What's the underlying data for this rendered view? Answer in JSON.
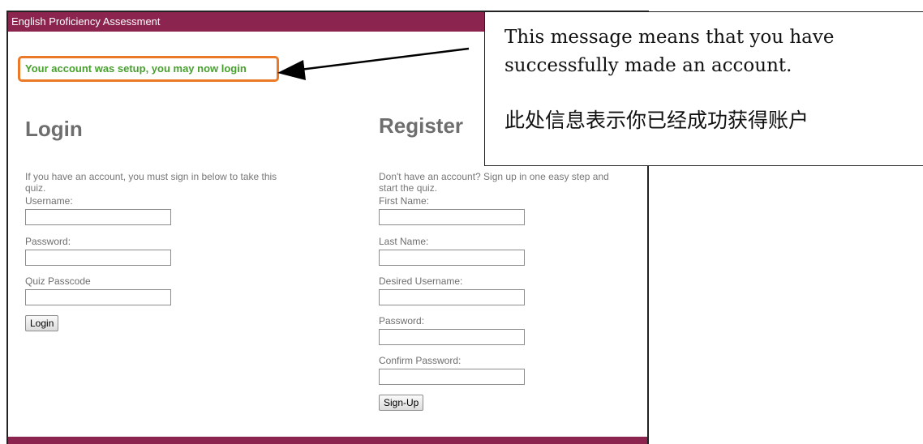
{
  "window": {
    "title": "English Proficiency Assessment"
  },
  "notice": {
    "text": "Your account was setup, you may now login"
  },
  "login": {
    "heading": "Login",
    "description": "If you have an account, you must sign in below to take this quiz.",
    "username_label": "Username:",
    "password_label": "Password:",
    "passcode_label": "Quiz Passcode",
    "button_label": "Login"
  },
  "register": {
    "heading": "Register",
    "description": "Don't have an account? Sign up in one easy step and start the quiz.",
    "first_name_label": "First Name:",
    "last_name_label": "Last Name:",
    "username_label": "Desired Username:",
    "password_label": "Password:",
    "confirm_label": "Confirm Password:",
    "button_label": "Sign-Up"
  },
  "callout": {
    "english": "This message means that you have successfully made an account.",
    "chinese": "此处信息表示你已经成功获得账户"
  },
  "colors": {
    "brand": "#8b2550",
    "notice_border": "#ea7a28",
    "notice_text": "#46a02c"
  }
}
